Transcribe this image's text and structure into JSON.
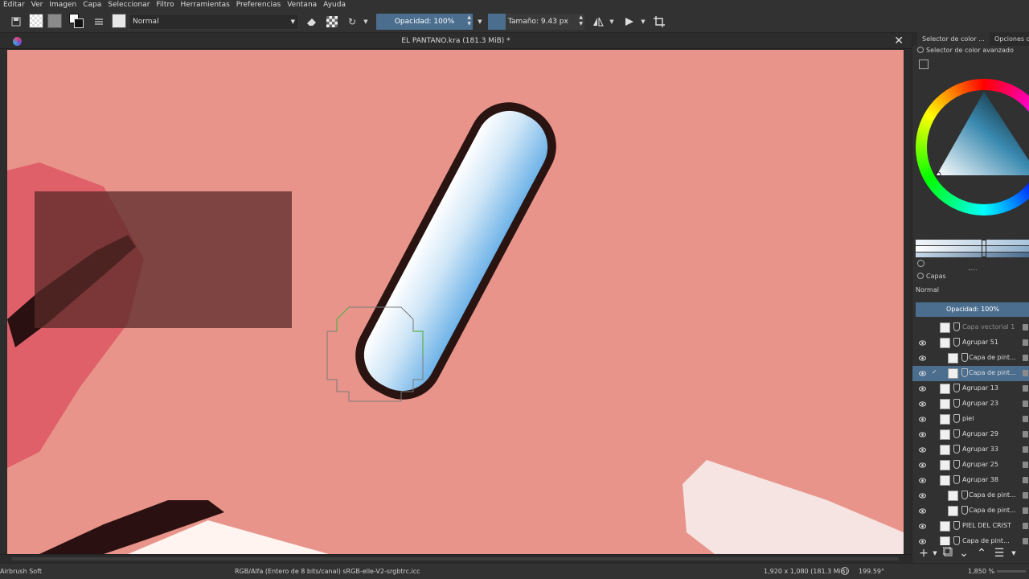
{
  "menubar": {
    "items": [
      "Editar",
      "Ver",
      "Imagen",
      "Capa",
      "Seleccionar",
      "Filtro",
      "Herramientas",
      "Preferencias",
      "Ventana",
      "Ayuda"
    ]
  },
  "toolbar": {
    "blend_mode": "Normal",
    "opacity_label": "Opacidad: 100%",
    "size_label": "Tamaño: 9.43 px"
  },
  "document": {
    "title": "EL PANTANO.kra (181.3 MiB) *"
  },
  "docker": {
    "tabs": [
      "Selector de color ...",
      "Opciones de"
    ],
    "color_selector_title": "Selector de color avanzado",
    "layers_title": "Capas",
    "layers_blend": "Normal",
    "layers_opacity": "Opacidad:  100%",
    "layers": [
      {
        "name": "Capa vectorial 1",
        "visible": false,
        "selected": false
      },
      {
        "name": "Agrupar 51",
        "visible": true,
        "selected": false
      },
      {
        "name": "Capa de pint...",
        "visible": true,
        "selected": false
      },
      {
        "name": "Capa de pint...",
        "visible": true,
        "selected": true
      },
      {
        "name": "Agrupar 13",
        "visible": true,
        "selected": false
      },
      {
        "name": "Agrupar 23",
        "visible": true,
        "selected": false
      },
      {
        "name": "piel",
        "visible": true,
        "selected": false
      },
      {
        "name": "Agrupar 29",
        "visible": true,
        "selected": false
      },
      {
        "name": "Agrupar 33",
        "visible": true,
        "selected": false
      },
      {
        "name": "Agrupar 25",
        "visible": true,
        "selected": false
      },
      {
        "name": "Agrupar 38",
        "visible": true,
        "selected": false
      },
      {
        "name": "Capa de pint...",
        "visible": true,
        "selected": false
      },
      {
        "name": "Capa de pint...",
        "visible": true,
        "selected": false
      },
      {
        "name": "PIEL DEL CRIST",
        "visible": true,
        "selected": false
      },
      {
        "name": "Capa de pint...",
        "visible": true,
        "selected": false
      }
    ]
  },
  "status": {
    "brush": "Airbrush Soft",
    "color_profile": "RGB/Alfa (Entero de 8 bits/canal)  sRGB-elle-V2-srgbtrc.icc",
    "dimensions": "1,920 x 1,080 (181.3 MiB)",
    "rotation": "199.59°",
    "zoom": "1,850 %"
  },
  "colors": {
    "canvas": "#e8948a",
    "accent": "#4b6e8f",
    "panel": "#313131"
  }
}
